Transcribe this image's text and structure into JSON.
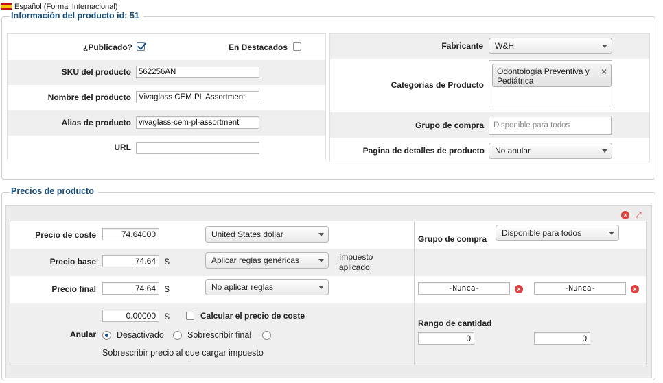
{
  "language": {
    "label": "Español (Formal Internacional)"
  },
  "product_info": {
    "legend": "Información del producto id: 51",
    "published_label": "¿Publicado?",
    "published": true,
    "featured_label": "En Destacados",
    "featured": false,
    "sku_label": "SKU del producto",
    "sku_value": "562256AN",
    "name_label": "Nombre del producto",
    "name_value": "Vivaglass CEM PL Assortment",
    "alias_label": "Alias de producto",
    "alias_value": "vivaglass-cem-pl-assortment",
    "url_label": "URL",
    "url_value": "",
    "manufacturer_label": "Fabricante",
    "manufacturer_value": "W&H",
    "categories_label": "Categorías de Producto",
    "categories": [
      "Odontología Preventiva y Pediátrica"
    ],
    "category_remove": "×",
    "shopper_group_label": "Grupo de compra",
    "shopper_group_placeholder": "Disponible para todos",
    "details_page_label": "Pagina de detalles de producto",
    "details_page_value": "No anular"
  },
  "prices": {
    "legend": "Precios de producto",
    "cost_label": "Precio de coste",
    "cost_value": "74.64000",
    "currency_value": "United States dollar",
    "base_label": "Precio base",
    "base_value": "74.64",
    "base_currency_symbol": "$",
    "base_rule_value": "Aplicar reglas genéricas",
    "tax_applied_label_1": "Impuesto",
    "tax_applied_label_2": "aplicado:",
    "final_label": "Precio final",
    "final_value": "74.64",
    "final_currency_symbol": "$",
    "final_rule_value": "No aplicar reglas",
    "override_label": "Anular",
    "override_value": "0.00000",
    "override_currency_symbol": "$",
    "calc_cost_label": "Calcular el precio de coste",
    "radio_disabled_label": "Desactivado",
    "radio_override_final_label": "Sobrescribir final",
    "override_tax_text": "Sobrescribir precio al que cargar impuesto",
    "shopper_group_label": "Grupo de compra",
    "shopper_group_value": "Disponible para todos",
    "date_from": "-Nunca-",
    "date_to": "-Nunca-",
    "quantity_range_label": "Rango de cantidad",
    "quantity_from": "0",
    "quantity_to": "0"
  }
}
